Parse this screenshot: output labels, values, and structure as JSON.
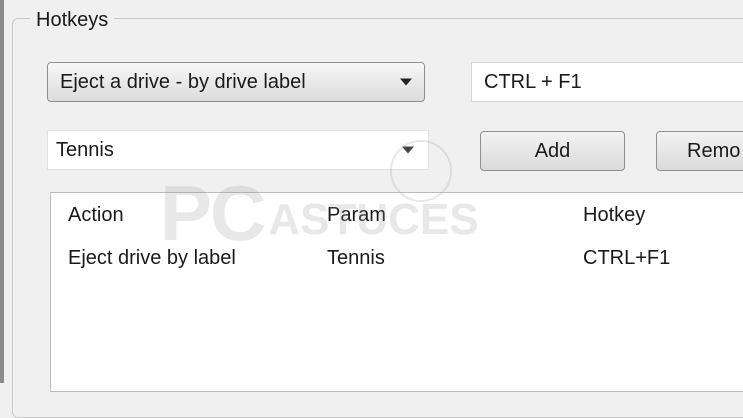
{
  "group": {
    "title": "Hotkeys"
  },
  "action_combo": {
    "value": "Eject a drive - by drive label"
  },
  "hotkey_input": {
    "value": "CTRL + F1"
  },
  "param_combo": {
    "value": "Tennis"
  },
  "buttons": {
    "add": "Add",
    "remove": "Remo"
  },
  "list": {
    "columns": [
      "Action",
      "Param",
      "Hotkey"
    ],
    "rows": [
      [
        "Eject drive by label",
        "Tennis",
        "CTRL+F1"
      ]
    ]
  },
  "watermark": {
    "part1": "PC",
    "part2": "ASTUCES"
  }
}
